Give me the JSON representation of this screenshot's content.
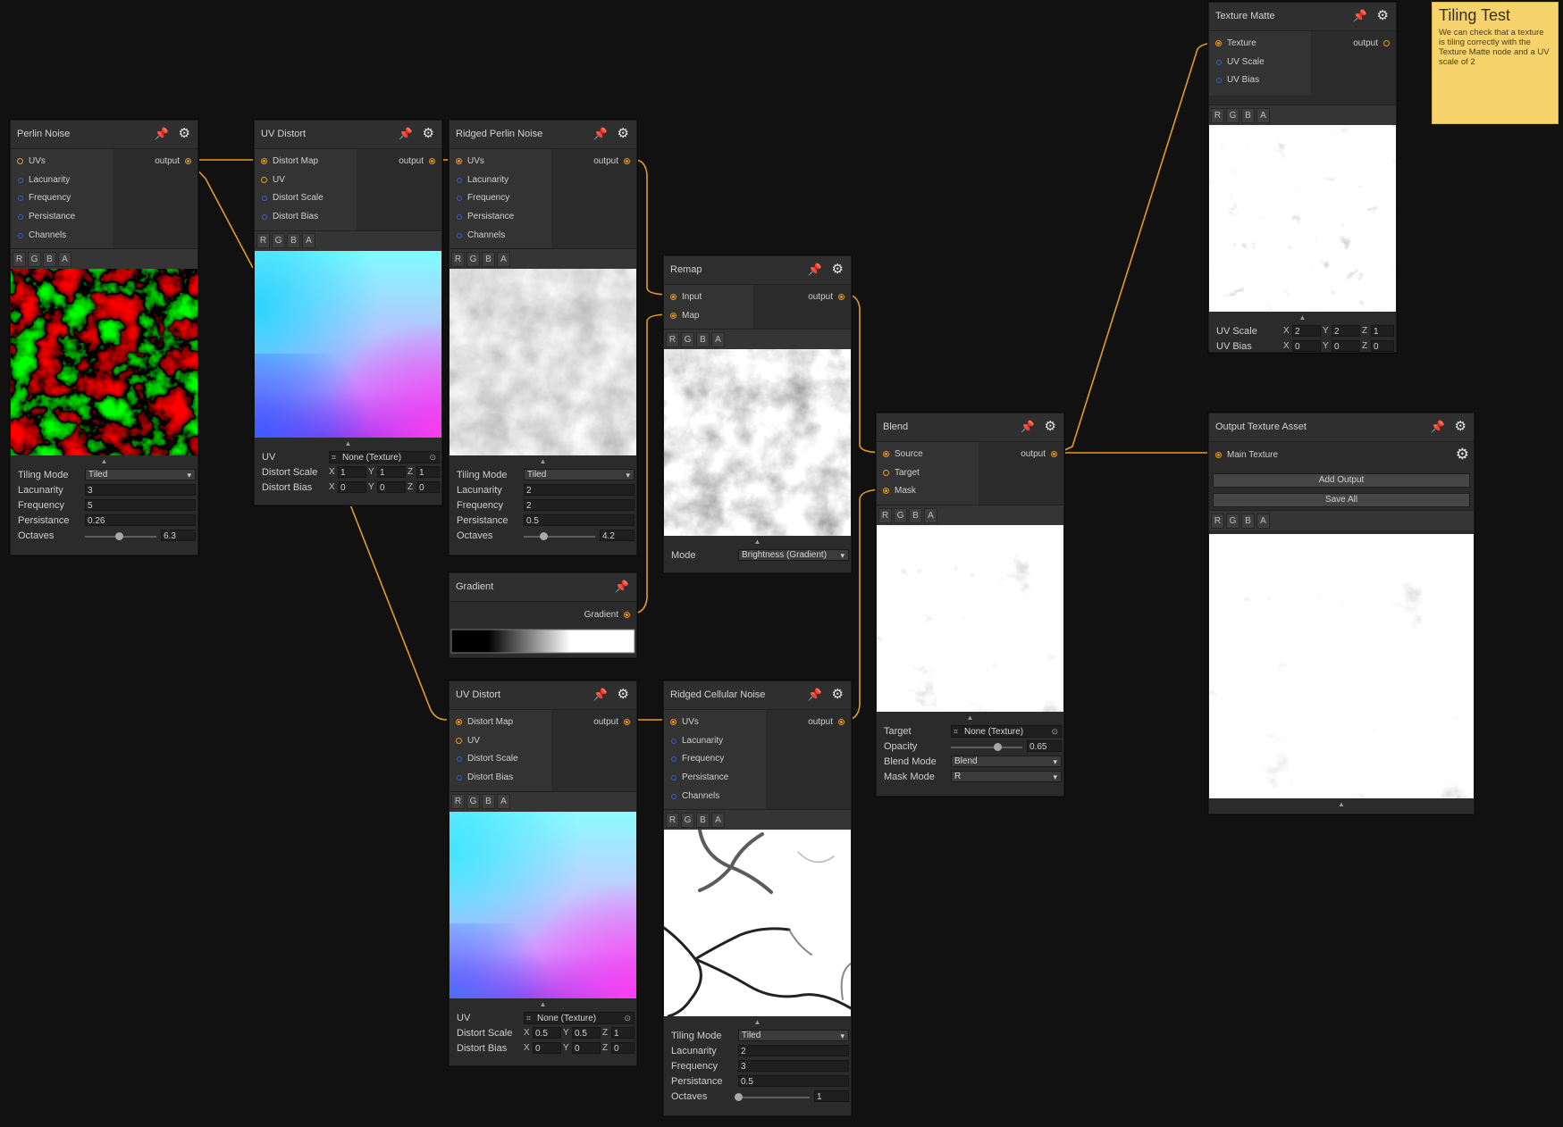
{
  "nodes": {
    "perlin": {
      "title": "Perlin Noise",
      "inputs": [
        "UVs",
        "Lacunarity",
        "Frequency",
        "Persistance",
        "Channels"
      ],
      "output": "output",
      "channels": [
        "R",
        "G",
        "B",
        "A"
      ],
      "props": {
        "tiling_mode_label": "Tiling Mode",
        "tiling_mode": "Tiled",
        "lacunarity_label": "Lacunarity",
        "lacunarity": "3",
        "frequency_label": "Frequency",
        "frequency": "5",
        "persistance_label": "Persistance",
        "persistance": "0.26",
        "octaves_label": "Octaves",
        "octaves": "6.3",
        "octaves_fraction": 0.48
      }
    },
    "uvd1": {
      "title": "UV Distort",
      "inputs": [
        "Distort Map",
        "UV",
        "Distort Scale",
        "Distort Bias"
      ],
      "output": "output",
      "channels": [
        "R",
        "G",
        "B",
        "A"
      ],
      "props": {
        "uv_label": "UV",
        "uv": "None (Texture)",
        "scale_label": "Distort Scale",
        "scale": {
          "x": "1",
          "y": "1",
          "z": "1"
        },
        "bias_label": "Distort Bias",
        "bias": {
          "x": "0",
          "y": "0",
          "z": "0"
        }
      }
    },
    "ridged": {
      "title": "Ridged Perlin Noise",
      "inputs": [
        "UVs",
        "Lacunarity",
        "Frequency",
        "Persistance",
        "Channels"
      ],
      "output": "output",
      "channels": [
        "R",
        "G",
        "B",
        "A"
      ],
      "props": {
        "tiling_mode_label": "Tiling Mode",
        "tiling_mode": "Tiled",
        "lacunarity_label": "Lacunarity",
        "lacunarity": "2",
        "frequency_label": "Frequency",
        "frequency": "2",
        "persistance_label": "Persistance",
        "persistance": "0.5",
        "octaves_label": "Octaves",
        "octaves": "4.2",
        "octaves_fraction": 0.28
      }
    },
    "gradient": {
      "title": "Gradient",
      "output": "Gradient"
    },
    "remap": {
      "title": "Remap",
      "inputs": [
        "Input",
        "Map"
      ],
      "output": "output",
      "channels": [
        "R",
        "G",
        "B",
        "A"
      ],
      "props": {
        "mode_label": "Mode",
        "mode": "Brightness (Gradient)"
      }
    },
    "uvd2": {
      "title": "UV Distort",
      "inputs": [
        "Distort Map",
        "UV",
        "Distort Scale",
        "Distort Bias"
      ],
      "output": "output",
      "channels": [
        "R",
        "G",
        "B",
        "A"
      ],
      "props": {
        "uv_label": "UV",
        "uv": "None (Texture)",
        "scale_label": "Distort Scale",
        "scale": {
          "x": "0.5",
          "y": "0.5",
          "z": "1"
        },
        "bias_label": "Distort Bias",
        "bias": {
          "x": "0",
          "y": "0",
          "z": "0"
        }
      }
    },
    "cellular": {
      "title": "Ridged Cellular Noise",
      "inputs": [
        "UVs",
        "Lacunarity",
        "Frequency",
        "Persistance",
        "Channels"
      ],
      "output": "output",
      "channels": [
        "R",
        "G",
        "B",
        "A"
      ],
      "props": {
        "tiling_mode_label": "Tiling Mode",
        "tiling_mode": "Tiled",
        "lacunarity_label": "Lacunarity",
        "lacunarity": "2",
        "frequency_label": "Frequency",
        "frequency": "3",
        "persistance_label": "Persistance",
        "persistance": "0.5",
        "octaves_label": "Octaves",
        "octaves": "1",
        "octaves_fraction": 0.0
      }
    },
    "blend": {
      "title": "Blend",
      "inputs": [
        "Source",
        "Target",
        "Mask"
      ],
      "output": "output",
      "channels": [
        "R",
        "G",
        "B",
        "A"
      ],
      "props": {
        "target_label": "Target",
        "target": "None (Texture)",
        "opacity_label": "Opacity",
        "opacity": "0.65",
        "opacity_fraction": 0.65,
        "blend_mode_label": "Blend Mode",
        "blend_mode": "Blend",
        "mask_mode_label": "Mask Mode",
        "mask_mode": "R"
      }
    },
    "matte": {
      "title": "Texture Matte",
      "inputs": [
        "Texture",
        "UV Scale",
        "UV Bias"
      ],
      "output": "output",
      "channels": [
        "R",
        "G",
        "B",
        "A"
      ],
      "props": {
        "scale_label": "UV Scale",
        "scale": {
          "x": "2",
          "y": "2",
          "z": "1"
        },
        "bias_label": "UV Bias",
        "bias": {
          "x": "0",
          "y": "0",
          "z": "0"
        }
      }
    },
    "output": {
      "title": "Output Texture Asset",
      "input": "Main Texture",
      "add_output": "Add Output",
      "save_all": "Save All",
      "channels": [
        "R",
        "G",
        "B",
        "A"
      ]
    }
  },
  "note": {
    "title": "Tiling Test",
    "body": "We can check that a texture is tiling correctly with the Texture Matte node and a UV scale of 2"
  },
  "axes": {
    "x": "X",
    "y": "Y",
    "z": "Z"
  },
  "colors": {
    "background": "#111111",
    "wire": "#e49b2a",
    "node": "#2b2b2b",
    "note": "#f7d36b"
  }
}
